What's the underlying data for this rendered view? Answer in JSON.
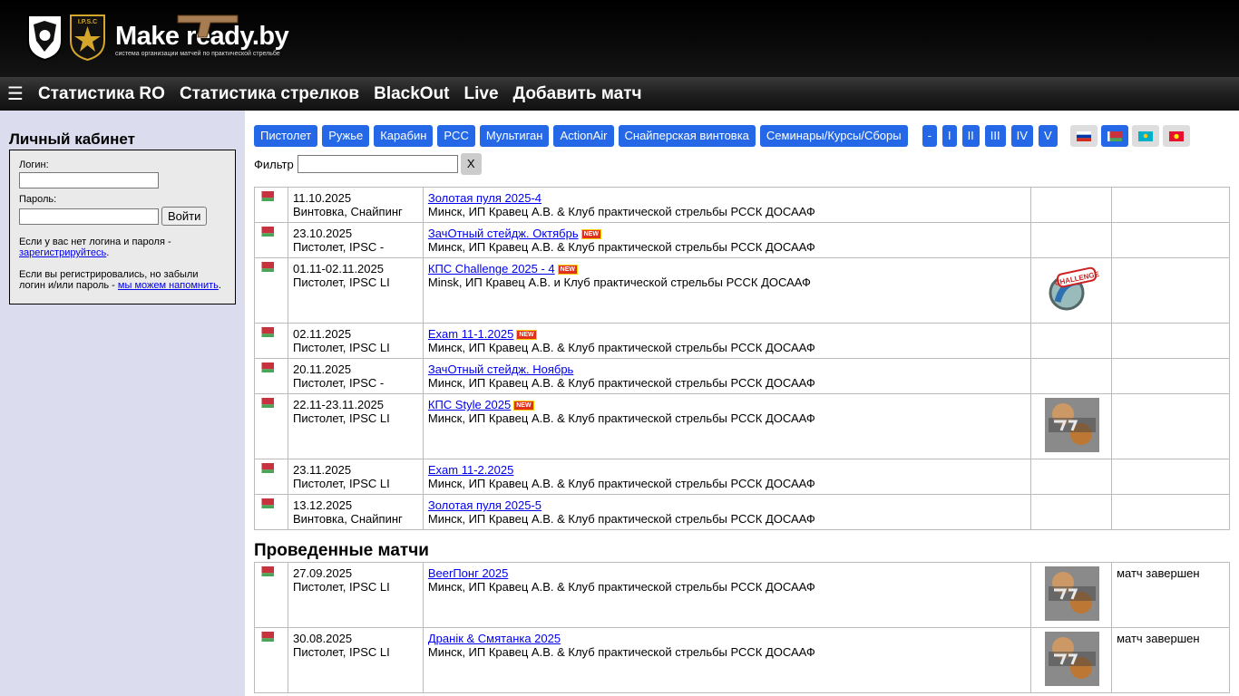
{
  "brand": {
    "title": "Make ready.by",
    "subtitle": "система организации матчей по практической стрельбе",
    "badge_text": "I.P.S.C"
  },
  "nav": {
    "menu_icon": "☰",
    "items": [
      "Статистика RO",
      "Статистика стрелков",
      "BlackOut",
      "Live",
      "Добавить матч"
    ]
  },
  "sidebar": {
    "title": "Личный кабинет",
    "login_label": "Логин:",
    "password_label": "Пароль:",
    "login_value": "",
    "password_value": "",
    "submit": "Войти",
    "help1_text": "Если у вас нет логина и пароля -",
    "help1_link": "зарегистрируйтесь",
    "help1_end": ".",
    "help2_text": "Если вы регистрировались, но забыли логин и/или пароль -",
    "help2_link": "мы можем напомнить",
    "help2_end": "."
  },
  "filters": {
    "categories": [
      "Пистолет",
      "Ружье",
      "Карабин",
      "PCC",
      "Мультиган",
      "ActionAir",
      "Снайперская винтовка",
      "Семинары/Курсы/Сборы"
    ],
    "levels": [
      "-",
      "I",
      "II",
      "III",
      "IV",
      "V"
    ],
    "flags": [
      "ru-flag",
      "by-flag",
      "kz-flag",
      "kg-flag"
    ],
    "active_flag": "by-flag",
    "filter_label": "Фильтр",
    "filter_value": "",
    "clear_label": "X"
  },
  "upcoming": [
    {
      "date": "11.10.2025",
      "type": "Винтовка, Снайпинг",
      "name": "Золотая пуля 2025-4",
      "new": false,
      "place": "Минск, ИП Кравец А.В. & Клуб практической стрельбы РССК ДОСААФ",
      "image": "",
      "status": ""
    },
    {
      "date": "23.10.2025",
      "type": "Пистолет, IPSC -",
      "name": "ЗачОтный стейдж. Октябрь",
      "new": true,
      "place": "Минск, ИП Кравец А.В. & Клуб практической стрельбы РССК ДОСААФ",
      "image": "",
      "status": ""
    },
    {
      "date": "01.11-02.11.2025",
      "type": "Пистолет, IPSC LI",
      "name": "КПС Challenge 2025 - 4",
      "new": true,
      "place": "Minsk, ИП Кравец А.В. и Клуб практической стрельбы РССК ДОСААФ",
      "image": "challenge-logo",
      "status": ""
    },
    {
      "date": "02.11.2025",
      "type": "Пистолет, IPSC LI",
      "name": "Exam 11-1.2025",
      "new": true,
      "place": "Минск, ИП Кравец А.В. & Клуб практической стрельбы РССК ДОСААФ",
      "image": "",
      "status": ""
    },
    {
      "date": "20.11.2025",
      "type": "Пистолет, IPSC -",
      "name": "ЗачОтный стейдж. Ноябрь",
      "new": false,
      "place": "Минск, ИП Кравец А.В. & Клуб практической стрельбы РССК ДОСААФ",
      "image": "",
      "status": ""
    },
    {
      "date": "22.11-23.11.2025",
      "type": "Пистолет, IPSC LI",
      "name": "КПС Style 2025",
      "new": true,
      "place": "Минск, ИП Кравец А.В. & Клуб практической стрельбы РССК ДОСААФ",
      "image": "club-logo",
      "status": ""
    },
    {
      "date": "23.11.2025",
      "type": "Пистолет, IPSC LI",
      "name": "Exam 11-2.2025",
      "new": false,
      "place": "Минск, ИП Кравец А.В. & Клуб практической стрельбы РССК ДОСААФ",
      "image": "",
      "status": ""
    },
    {
      "date": "13.12.2025",
      "type": "Винтовка, Снайпинг",
      "name": "Золотая пуля 2025-5",
      "new": false,
      "place": "Минск, ИП Кравец А.В. & Клуб практической стрельбы РССК ДОСААФ",
      "image": "",
      "status": ""
    }
  ],
  "past_title": "Проведенные матчи",
  "past": [
    {
      "date": "27.09.2025",
      "type": "Пистолет, IPSC LI",
      "name": "BeerПонг 2025",
      "new": false,
      "place": "Минск, ИП Кравец А.В. & Клуб практической стрельбы РССК ДОСААФ",
      "image": "club-logo",
      "status": "матч завершен"
    },
    {
      "date": "30.08.2025",
      "type": "Пистолет, IPSC LI",
      "name": "Дранік & Смятанка 2025",
      "new": false,
      "place": "Минск, ИП Кравец А.В. & Клуб практической стрельбы РССК ДОСААФ",
      "image": "club-logo",
      "status": "матч завершен"
    }
  ],
  "new_badge": "NEW",
  "colors": {
    "accent": "#2468e8",
    "nav_bg": "#1f1f1f",
    "sidebar_bg": "#dcdcef",
    "link": "#0000ee"
  }
}
